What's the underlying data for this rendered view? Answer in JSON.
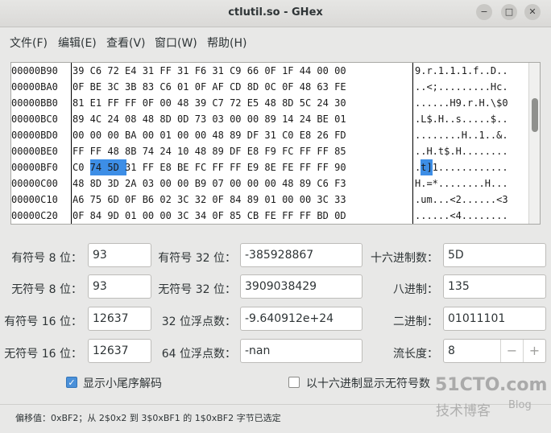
{
  "window": {
    "title": "ctlutil.so - GHex",
    "min_icon": "−",
    "max_icon": "□",
    "close_icon": "✕"
  },
  "menu": [
    "文件(F)",
    "编辑(E)",
    "查看(V)",
    "窗口(W)",
    "帮助(H)"
  ],
  "hex_rows": [
    {
      "offset": "00000B90",
      "hex": "39 C6 72 E4 31 FF 31 F6 31 C9 66 0F 1F 44 00 00",
      "ascii": "9.r.1.1.1.f..D.."
    },
    {
      "offset": "00000BA0",
      "hex": "0F BE 3C 3B 83 C6 01 0F AF CD 8D 0C 0F 48 63 FE",
      "ascii": "..<;.........Hc."
    },
    {
      "offset": "00000BB0",
      "hex": "81 E1 FF FF 0F 00 48 39 C7 72 E5 48 8D 5C 24 30",
      "ascii": "......H9.r.H.\\$0"
    },
    {
      "offset": "00000BC0",
      "hex": "89 4C 24 08 48 8D 0D 73 03 00 00 89 14 24 BE 01",
      "ascii": ".L$.H..s.....$.."
    },
    {
      "offset": "00000BD0",
      "hex": "00 00 00 BA 00 01 00 00 48 89 DF 31 C0 E8 26 FD",
      "ascii": "........H..1..&."
    },
    {
      "offset": "00000BE0",
      "hex": "FF FF 48 8B 74 24 10 48 89 DF E8 F9 FC FF FF 85",
      "ascii": "..H.t$.H........"
    },
    {
      "offset": "00000BF0",
      "hex": "C0 74 5D 31 FF E8 BE FC FF FF E9 8E FE FF FF 90",
      "ascii": ".t]1............"
    },
    {
      "offset": "00000C00",
      "hex": "48 8D 3D 2A 03 00 00 B9 07 00 00 00 48 89 C6 F3",
      "ascii": "H.=*........H..."
    },
    {
      "offset": "00000C10",
      "hex": "A6 75 6D 0F B6 02 3C 32 0F 84 89 01 00 00 3C 33",
      "ascii": ".um...<2......<3"
    },
    {
      "offset": "00000C20",
      "hex": "0F 84 9D 01 00 00 3C 34 0F 85 CB FE FF FF BD 0D",
      "ascii": "......<4........"
    }
  ],
  "fields": {
    "s8_label": "有符号 8 位：",
    "s8": "93",
    "u8_label": "无符号 8 位：",
    "u8": "93",
    "s16_label": "有符号 16 位：",
    "s16": "12637",
    "u16_label": "无符号 16 位：",
    "u16": "12637",
    "s32_label": "有符号 32 位：",
    "s32": "-385928867",
    "u32_label": "无符号 32 位：",
    "u32": "3909038429",
    "f32_label": "32 位浮点数：",
    "f32": "-9.640912e+24",
    "f64_label": "64 位浮点数：",
    "f64": "-nan",
    "hex_label": "十六进制数：",
    "hex": "5D",
    "oct_label": "八进制：",
    "oct": "135",
    "bin_label": "二进制：",
    "bin": "01011101",
    "len_label": "流长度：",
    "len": "8",
    "minus": "−",
    "plus": "+"
  },
  "options": {
    "little_endian": "显示小尾序解码",
    "little_endian_checked": true,
    "check_mark": "✓",
    "hex_unsigned": "以十六进制显示无符号数",
    "hex_unsigned_checked": false
  },
  "status": "偏移值：0xBF2；从 2$0x2 到 3$0xBF1 的 1$0xBF2 字节已选定",
  "watermark": {
    "line1": "51CTO.com",
    "line2": "技术博客",
    "line3": "Blog"
  }
}
